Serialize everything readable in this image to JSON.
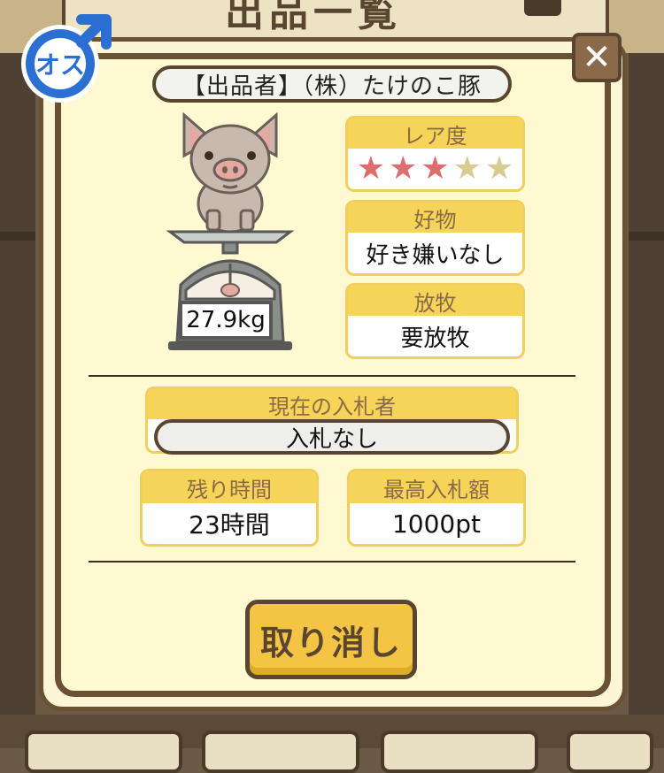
{
  "background": {
    "header_title": "出品一覧"
  },
  "badge": {
    "gender_label": "オス",
    "icon": "male-symbol-icon"
  },
  "close": {
    "icon": "close-icon",
    "glyph": "✕"
  },
  "seller": {
    "label": "【出品者】（株）たけのこ豚"
  },
  "pig": {
    "icon": "pig-on-scale-icon",
    "weight": "27.9kg"
  },
  "rarity": {
    "title": "レア度",
    "stars_total": 5,
    "stars_filled": 3
  },
  "favorite": {
    "title": "好物",
    "value": "好き嫌いなし"
  },
  "grazing": {
    "title": "放牧",
    "value": "要放牧"
  },
  "current_bidder": {
    "title": "現在の入札者",
    "value": "入札なし"
  },
  "time_left": {
    "title": "残り時間",
    "value": "23時間"
  },
  "highest_bid": {
    "title": "最高入札額",
    "value": "1000pt"
  },
  "actions": {
    "cancel_label": "取り消し"
  },
  "colors": {
    "frame": "#6b5134",
    "panel": "#fff9d2",
    "card_header": "#f6d458",
    "star_on": "#e06d6d",
    "star_off": "#d9cc92",
    "male_blue": "#2a6fd1",
    "button": "#f4c545"
  }
}
